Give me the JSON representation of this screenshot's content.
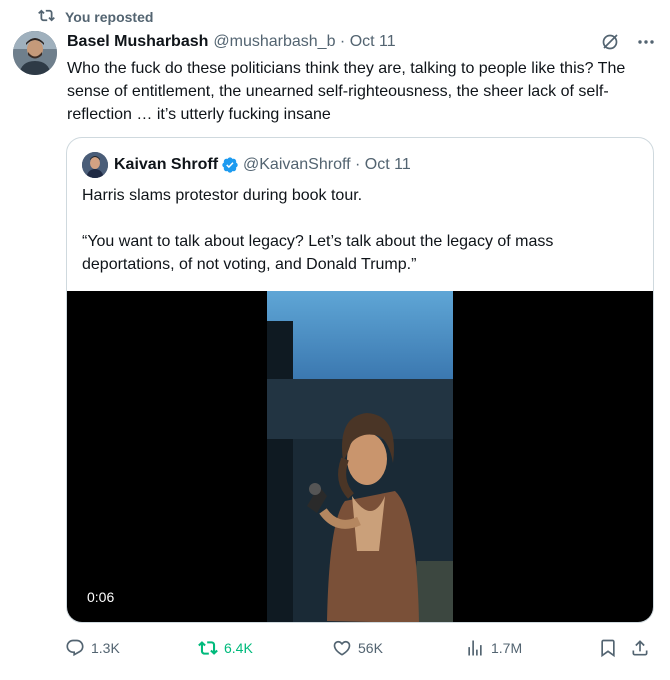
{
  "repost_banner": {
    "label": "You reposted",
    "color": "#536471",
    "icon": "repost-icon"
  },
  "post": {
    "author_name": "Basel Musharbash",
    "meta": "@musharbash_b · Oct 11",
    "text": "Who the fuck do these politicians think they are, talking to people like this? The sense of entitlement, the unearned self-righteousness, the sheer lack of self-reflection … it’s utterly fucking insane",
    "icons": [
      "grok-icon",
      "more-icon"
    ]
  },
  "quoted_post": {
    "author_name": "Kaivan Shroff",
    "meta": "@KaivanShroff · Oct 11",
    "verified": true,
    "verified_color": "#1d9bf0",
    "text_line1": "Harris slams protestor during book tour.",
    "text_line2": "“You want to talk about legacy? Let’s talk about the legacy of mass deportations, of not voting, and Donald Trump.”",
    "video": {
      "duration": "0:06"
    }
  },
  "actions": {
    "replies": "1.3K",
    "reposts": "6.4K",
    "likes": "56K",
    "views": "1.7M",
    "repost_active_color": "#00ba7c"
  }
}
